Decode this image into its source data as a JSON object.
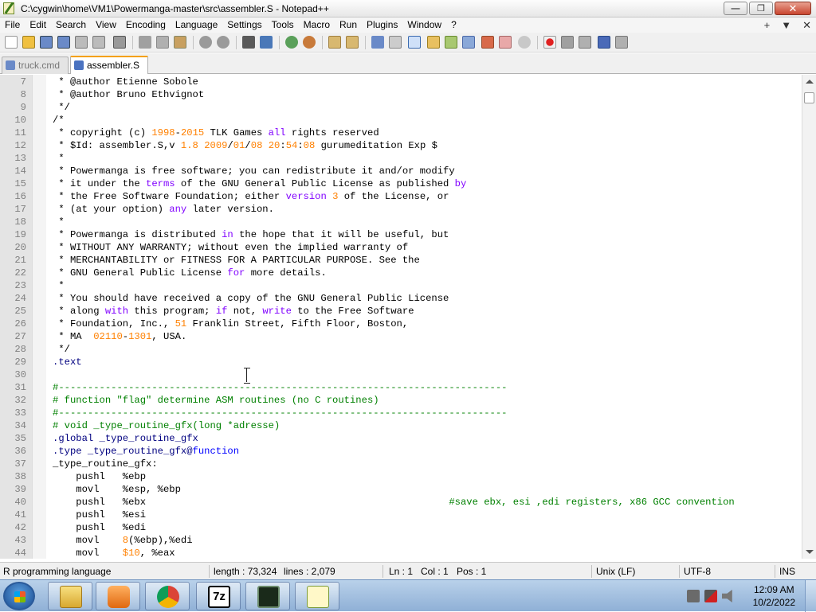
{
  "window": {
    "title": "C:\\cygwin\\home\\VM1\\Powermanga-master\\src\\assembler.S - Notepad++",
    "minimize_glyph": "—",
    "maximize_glyph": "❐",
    "close_glyph": "✕"
  },
  "menu": {
    "items": [
      "File",
      "Edit",
      "Search",
      "View",
      "Encoding",
      "Language",
      "Settings",
      "Tools",
      "Macro",
      "Run",
      "Plugins",
      "Window",
      "?"
    ],
    "plus_glyph": "+",
    "dropdown_glyph": "▼",
    "close_glyph": "✕"
  },
  "tabs": [
    {
      "label": "truck.cmd",
      "active": false
    },
    {
      "label": "assembler.S",
      "active": true
    }
  ],
  "tab_close_glyph": "✕",
  "editor": {
    "lines": [
      {
        "n": "7",
        "segs": [
          [
            " * @author Etienne Sobole",
            "c-com"
          ]
        ]
      },
      {
        "n": "8",
        "segs": [
          [
            " * @author Bruno Ethvignot",
            "c-com"
          ]
        ]
      },
      {
        "n": "9",
        "segs": [
          [
            " */",
            "c-com"
          ]
        ]
      },
      {
        "n": "10",
        "segs": [
          [
            "/*",
            "c-com"
          ]
        ]
      },
      {
        "n": "11",
        "segs": [
          [
            " * copyright (c) ",
            "c-com"
          ],
          [
            "1998",
            "c-num"
          ],
          [
            "-",
            "c-com"
          ],
          [
            "2015",
            "c-num"
          ],
          [
            " TLK Games ",
            "c-com"
          ],
          [
            "all",
            "c-kw"
          ],
          [
            " rights reserved",
            "c-com"
          ]
        ]
      },
      {
        "n": "12",
        "segs": [
          [
            " * $Id: assembler.S,v ",
            "c-com"
          ],
          [
            "1.8",
            "c-num"
          ],
          [
            " ",
            "c-com"
          ],
          [
            "2009",
            "c-num"
          ],
          [
            "/",
            "c-com"
          ],
          [
            "01",
            "c-num"
          ],
          [
            "/",
            "c-com"
          ],
          [
            "08",
            "c-num"
          ],
          [
            " ",
            "c-com"
          ],
          [
            "20",
            "c-num"
          ],
          [
            ":",
            "c-com"
          ],
          [
            "54",
            "c-num"
          ],
          [
            ":",
            "c-com"
          ],
          [
            "08",
            "c-num"
          ],
          [
            " gurumeditation Exp $",
            "c-com"
          ]
        ]
      },
      {
        "n": "13",
        "segs": [
          [
            " *",
            "c-com"
          ]
        ]
      },
      {
        "n": "14",
        "segs": [
          [
            " * Powermanga is free software; you can redistribute it and/or modify",
            "c-com"
          ]
        ]
      },
      {
        "n": "15",
        "segs": [
          [
            " * it under the ",
            "c-com"
          ],
          [
            "terms",
            "c-kw"
          ],
          [
            " of the GNU General Public License as published ",
            "c-com"
          ],
          [
            "by",
            "c-kw"
          ]
        ]
      },
      {
        "n": "16",
        "segs": [
          [
            " * the Free Software Foundation; either ",
            "c-com"
          ],
          [
            "version",
            "c-kw"
          ],
          [
            " ",
            "c-com"
          ],
          [
            "3",
            "c-num"
          ],
          [
            " of the License, or",
            "c-com"
          ]
        ]
      },
      {
        "n": "17",
        "segs": [
          [
            " * (at your option) ",
            "c-com"
          ],
          [
            "any",
            "c-kw"
          ],
          [
            " later version.",
            "c-com"
          ]
        ]
      },
      {
        "n": "18",
        "segs": [
          [
            " *",
            "c-com"
          ]
        ]
      },
      {
        "n": "19",
        "segs": [
          [
            " * Powermanga is distributed ",
            "c-com"
          ],
          [
            "in",
            "c-kw"
          ],
          [
            " the hope that it will be useful, but",
            "c-com"
          ]
        ]
      },
      {
        "n": "20",
        "segs": [
          [
            " * WITHOUT ANY WARRANTY; without even the implied warranty of",
            "c-com"
          ]
        ]
      },
      {
        "n": "21",
        "segs": [
          [
            " * MERCHANTABILITY or FITNESS FOR A PARTICULAR PURPOSE. See the",
            "c-com"
          ]
        ]
      },
      {
        "n": "22",
        "segs": [
          [
            " * GNU General Public License ",
            "c-com"
          ],
          [
            "for",
            "c-kw"
          ],
          [
            " more details.",
            "c-com"
          ]
        ]
      },
      {
        "n": "23",
        "segs": [
          [
            " *",
            "c-com"
          ]
        ]
      },
      {
        "n": "24",
        "segs": [
          [
            " * You should have received a copy of the GNU General Public License",
            "c-com"
          ]
        ]
      },
      {
        "n": "25",
        "segs": [
          [
            " * along ",
            "c-com"
          ],
          [
            "with",
            "c-kw"
          ],
          [
            " this program; ",
            "c-com"
          ],
          [
            "if",
            "c-kw"
          ],
          [
            " not, ",
            "c-com"
          ],
          [
            "write",
            "c-kw"
          ],
          [
            " to the Free Software",
            "c-com"
          ]
        ]
      },
      {
        "n": "26",
        "segs": [
          [
            " * Foundation, Inc., ",
            "c-com"
          ],
          [
            "51",
            "c-num"
          ],
          [
            " Franklin Street, Fifth Floor, Boston,",
            "c-com"
          ]
        ]
      },
      {
        "n": "27",
        "segs": [
          [
            " * MA  ",
            "c-com"
          ],
          [
            "02110",
            "c-num"
          ],
          [
            "-",
            "c-com"
          ],
          [
            "1301",
            "c-num"
          ],
          [
            ", USA.",
            "c-com"
          ]
        ]
      },
      {
        "n": "28",
        "segs": [
          [
            " */",
            "c-com"
          ]
        ]
      },
      {
        "n": "29",
        "segs": [
          [
            ".text",
            "c-dir"
          ]
        ]
      },
      {
        "n": "30",
        "segs": [
          [
            "",
            "c-com"
          ]
        ]
      },
      {
        "n": "31",
        "segs": [
          [
            "#-----------------------------------------------------------------------------",
            "c-green"
          ]
        ]
      },
      {
        "n": "32",
        "segs": [
          [
            "# function \"flag\" determine ASM routines (no C routines)",
            "c-green"
          ]
        ]
      },
      {
        "n": "33",
        "segs": [
          [
            "#-----------------------------------------------------------------------------",
            "c-green"
          ]
        ]
      },
      {
        "n": "34",
        "segs": [
          [
            "# void _type_routine_gfx(long *adresse)",
            "c-green"
          ]
        ]
      },
      {
        "n": "35",
        "segs": [
          [
            ".global _type_routine_gfx",
            "c-dir"
          ]
        ]
      },
      {
        "n": "36",
        "segs": [
          [
            ".type _type_routine_gfx@",
            "c-dir"
          ],
          [
            "function",
            "c-blue"
          ]
        ]
      },
      {
        "n": "37",
        "segs": [
          [
            "_type_routine_gfx:",
            "c-com"
          ]
        ]
      },
      {
        "n": "38",
        "segs": [
          [
            "    pushl   %ebp",
            "c-reg"
          ]
        ]
      },
      {
        "n": "39",
        "segs": [
          [
            "    movl    %esp, %ebp",
            "c-reg"
          ]
        ]
      },
      {
        "n": "40",
        "segs": [
          [
            "    pushl   %ebx                                                    ",
            "c-reg"
          ],
          [
            "#save ebx, esi ,edi registers, x86 GCC convention",
            "c-green"
          ]
        ]
      },
      {
        "n": "41",
        "segs": [
          [
            "    pushl   %esi",
            "c-reg"
          ]
        ]
      },
      {
        "n": "42",
        "segs": [
          [
            "    pushl   %edi",
            "c-reg"
          ]
        ]
      },
      {
        "n": "43",
        "segs": [
          [
            "    movl    ",
            "c-reg"
          ],
          [
            "8",
            "c-num"
          ],
          [
            "(%ebp),%edi",
            "c-reg"
          ]
        ]
      },
      {
        "n": "44",
        "segs": [
          [
            "    movl    ",
            "c-reg"
          ],
          [
            "$10",
            "c-num"
          ],
          [
            ", %eax",
            "c-reg"
          ]
        ]
      }
    ]
  },
  "status": {
    "language": "R programming language",
    "length": "length : 73,324",
    "lines": "lines : 2,079",
    "ln": "Ln : 1",
    "col": "Col : 1",
    "pos": "Pos : 1",
    "eol": "Unix (LF)",
    "encoding": "UTF-8",
    "mode": "INS"
  },
  "taskbar": {
    "apps": [
      "folder",
      "media-player",
      "chrome",
      "7zip",
      "terminal",
      "notepad++"
    ],
    "app_labels": {
      "7zip": "7z"
    },
    "clock_time": "12:09 AM",
    "clock_date": "10/2/2022"
  },
  "colors": {
    "comment": "#000000",
    "number": "#ff8000",
    "keyword": "#8000ff",
    "line_comment": "#008000",
    "directive": "#000080",
    "active_tab_accent": "#f4a000"
  }
}
